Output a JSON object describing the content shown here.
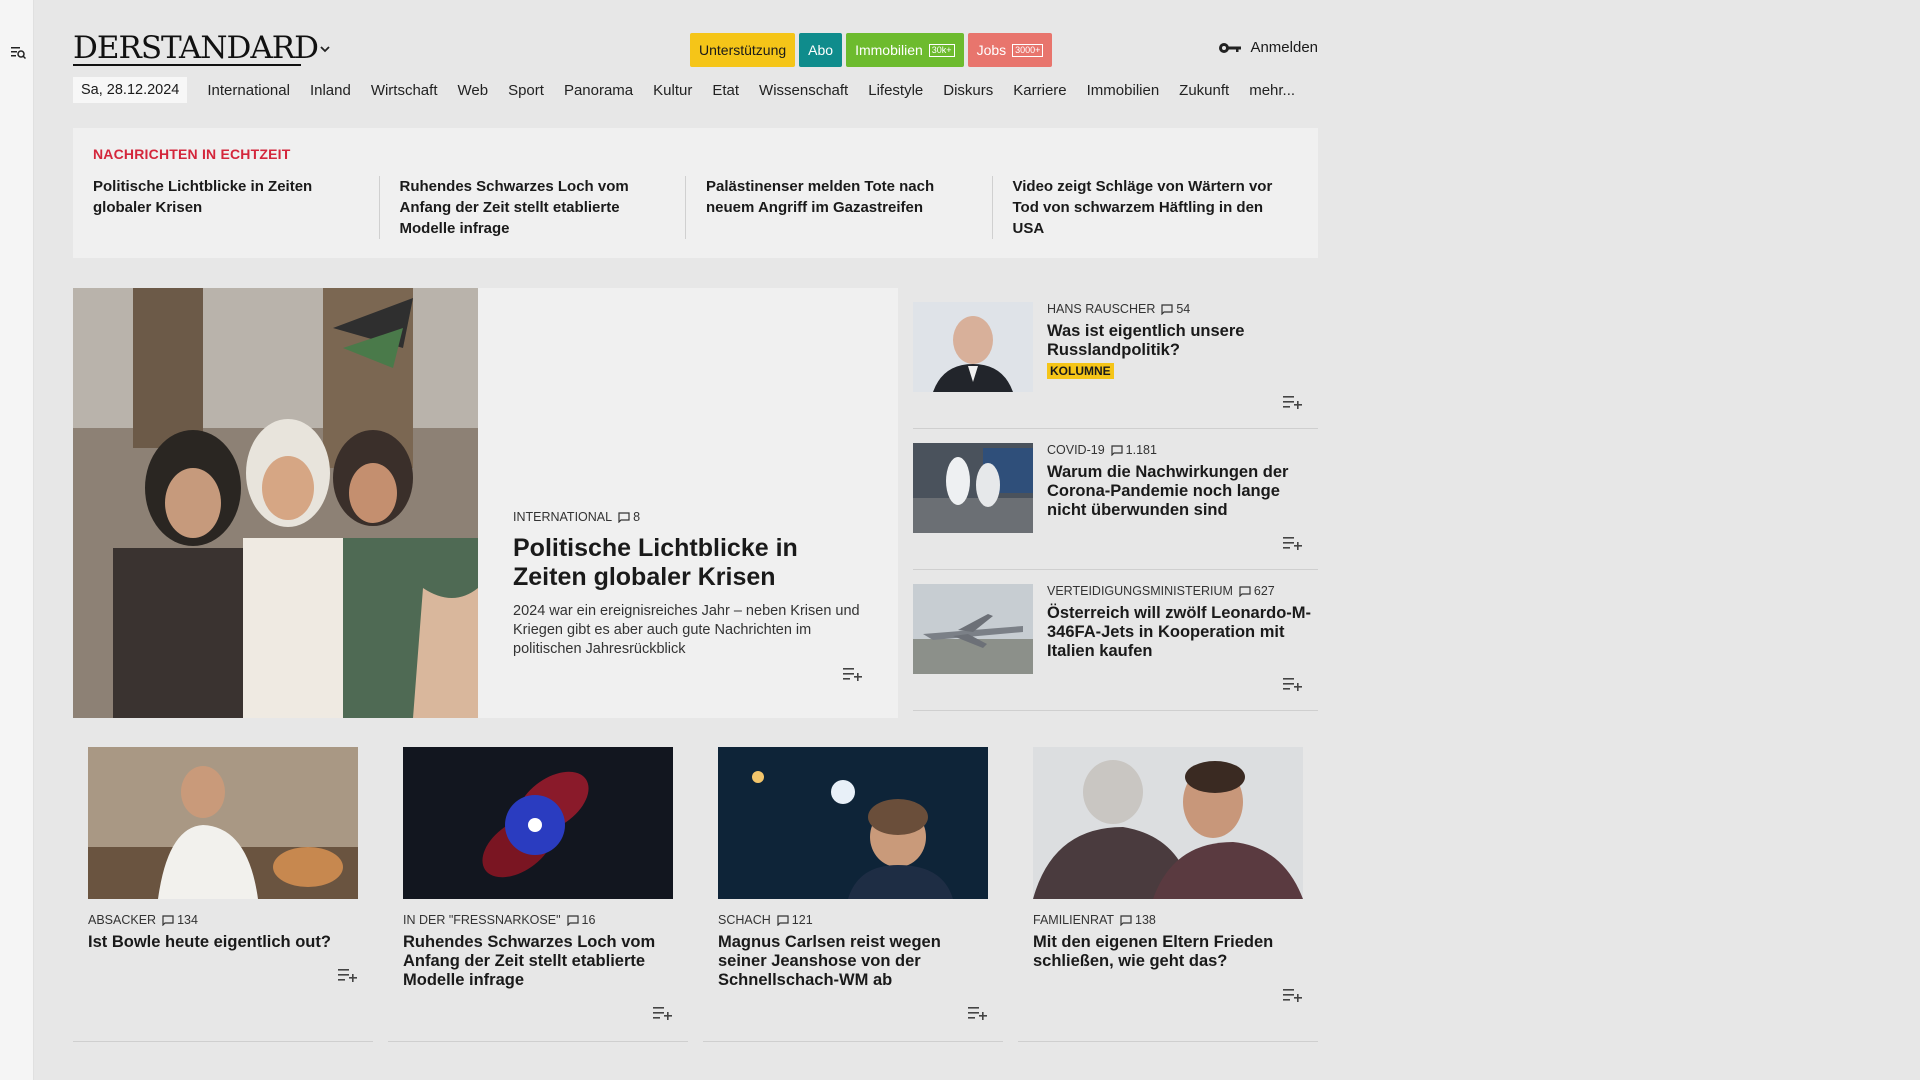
{
  "brand": {
    "logo": "DERSTANDARD"
  },
  "header": {
    "pills": [
      {
        "label": "Unterstützung",
        "badge": ""
      },
      {
        "label": "Abo",
        "badge": ""
      },
      {
        "label": "Immobilien",
        "badge": "30k+"
      },
      {
        "label": "Jobs",
        "badge": "3000+"
      }
    ],
    "login": "Anmelden"
  },
  "nav": {
    "date": "Sa, 28.12.2024",
    "items": [
      "International",
      "Inland",
      "Wirtschaft",
      "Web",
      "Sport",
      "Panorama",
      "Kultur",
      "Etat",
      "Wissenschaft",
      "Lifestyle",
      "Diskurs",
      "Karriere",
      "Immobilien",
      "Zukunft",
      "mehr..."
    ]
  },
  "ticker": {
    "title": "NACHRICHTEN IN ECHTZEIT",
    "items": [
      "Politische Lichtblicke in Zeiten globaler Krisen",
      "Ruhendes Schwarzes Loch vom Anfang der Zeit stellt etablierte Modelle infrage",
      "Palästinenser melden Tote nach neuem Angriff im Gazastreifen",
      "Video zeigt Schläge von Wärtern vor Tod von schwarzem Häftling in den USA"
    ]
  },
  "hero": {
    "kicker": "International",
    "comments": "8",
    "title": "Politische Lichtblicke in Zeiten globaler Krisen",
    "lead": "2024 war ein ereignisreiches Jahr – neben Krisen und Kriegen gibt es aber auch gute Nachrichten im politischen Jahresrückblick"
  },
  "side": [
    {
      "kicker": "Hans Rauscher",
      "comments": "54",
      "title": "Was ist eigentlich unsere Russlandpolitik?",
      "badge": "KOLUMNE"
    },
    {
      "kicker": "Covid-19",
      "comments": "1.181",
      "title": "Warum die Nachwirkungen der Corona-Pandemie noch lange nicht überwunden sind",
      "badge": ""
    },
    {
      "kicker": "Verteidigungsministerium",
      "comments": "627",
      "title": "Österreich will zwölf Leonardo-M-346FA-Jets in Kooperation mit Italien kaufen",
      "badge": ""
    }
  ],
  "cards": [
    {
      "kicker": "Absacker",
      "comments": "134",
      "title": "Ist Bowle heute eigentlich out?"
    },
    {
      "kicker": "In der \"Fressnarkose\"",
      "comments": "16",
      "title": "Ruhendes Schwarzes Loch vom Anfang der Zeit stellt etablierte Modelle infrage"
    },
    {
      "kicker": "Schach",
      "comments": "121",
      "title": "Magnus Carlsen reist wegen seiner Jeanshose von der Schnellschach-WM ab"
    },
    {
      "kicker": "Familienrat",
      "comments": "138",
      "title": "Mit den eigenen Eltern Frieden schließen, wie geht das?"
    }
  ]
}
